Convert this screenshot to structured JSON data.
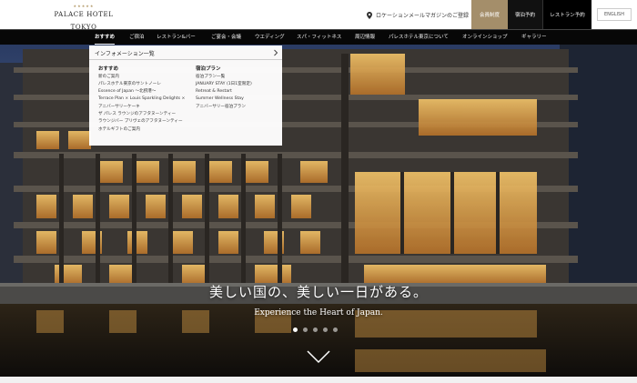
{
  "brand": {
    "name": "PALACE HOTEL TOKYO",
    "stars": "★★★★★"
  },
  "utility": {
    "location": "ロケーション",
    "magazine": "メールマガジンのご登録"
  },
  "actions": {
    "member": "会員制度",
    "stay": "宿泊予約",
    "restaurant": "レストラン予約",
    "lang": "ENGLISH"
  },
  "nav": [
    {
      "label": "おすすめ",
      "active": true
    },
    {
      "label": "ご宿泊"
    },
    {
      "label": "レストラン&バー"
    },
    {
      "label": "ご宴会・会議"
    },
    {
      "label": "ウエディング"
    },
    {
      "label": "スパ・フィットネス"
    },
    {
      "label": "周辺情報"
    },
    {
      "label": "パレスホテル東京について"
    },
    {
      "label": "オンラインショップ"
    },
    {
      "label": "ギャラリー"
    }
  ],
  "dropdown": {
    "selector": "インフォメーション一覧",
    "col1": {
      "title": "おすすめ",
      "links": [
        "新のご案内",
        "パレスホテル東京のサントノーレ",
        "Essence of Japan ～北摂港～",
        "Terrace Plan × Louis Sparkling Delights ×",
        "アニバーサリーケーキ",
        "ザ パレス ラウンジのアフタヌーンティー",
        "ラウンジバー プリヴェのアフタヌーンティー",
        "ホテルギフトのご案内"
      ]
    },
    "col2": {
      "title": "宿泊プラン",
      "links": [
        "宿泊プラン一覧",
        "JANUARY STAY (1日1室限定)",
        "Retreat & Restart",
        "Summer Wellness Stay",
        "アニバーサリー宿泊プラン"
      ]
    }
  },
  "hero": {
    "title": "美しい国の、美しい一日がある。",
    "subtitle": "Experience the Heart of Japan.",
    "slides": 5,
    "active_slide": 1
  },
  "colors": {
    "gold": "#a48e6a",
    "black": "#000000",
    "nav_bg": "#1a1a1a"
  }
}
